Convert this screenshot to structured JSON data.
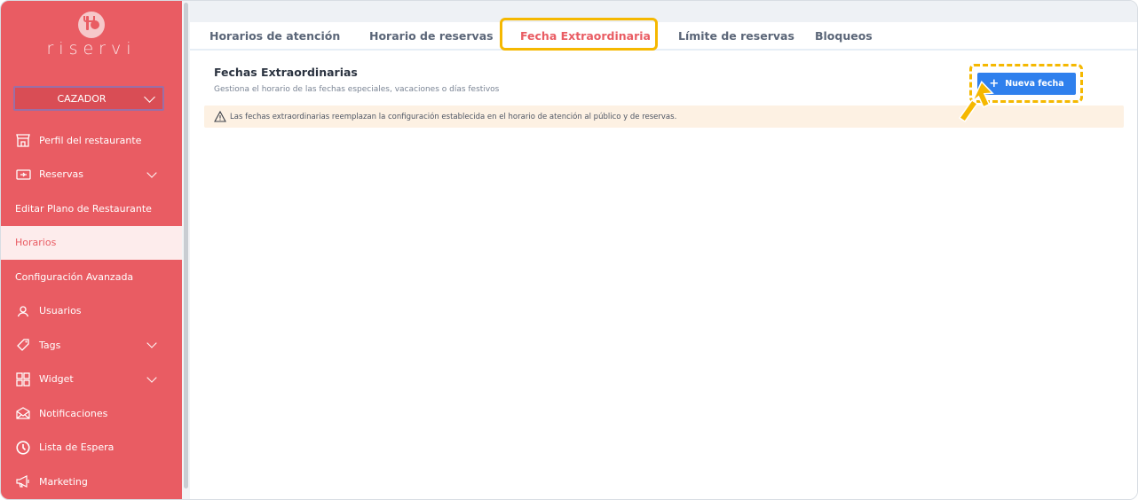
{
  "app": {
    "logo_text": "riservi"
  },
  "restaurant_select": {
    "value": "CAZADOR"
  },
  "sidebar": {
    "items": [
      {
        "label": "Perfil del restaurante",
        "icon": "store-icon"
      },
      {
        "label": "Reservas",
        "icon": "ticket-icon",
        "has_chevron": true
      },
      {
        "label": "Editar Plano de Restaurante"
      },
      {
        "label": "Horarios",
        "active": true
      },
      {
        "label": "Configuración Avanzada"
      },
      {
        "label": "Usuarios",
        "icon": "user-icon"
      },
      {
        "label": "Tags",
        "icon": "tag-icon",
        "has_chevron": true
      },
      {
        "label": "Widget",
        "icon": "widget-icon",
        "has_chevron": true
      },
      {
        "label": "Notificaciones",
        "icon": "mail-icon"
      },
      {
        "label": "Lista de Espera",
        "icon": "clock-icon"
      },
      {
        "label": "Marketing",
        "icon": "megaphone-icon"
      }
    ]
  },
  "tabs": [
    {
      "label": "Horarios de atención"
    },
    {
      "label": "Horario de reservas"
    },
    {
      "label": "Fecha Extraordinaria",
      "active": true
    },
    {
      "label": "Límite de reservas"
    },
    {
      "label": "Bloqueos"
    }
  ],
  "section": {
    "title": "Fechas Extraordinarias",
    "subtitle": "Gestiona el horario de las fechas especiales, vacaciones o días festivos",
    "notice": "Las fechas extraordinarias reemplazan la configuración establecida en el horario de atención al público y de reservas.",
    "new_button": "Nueva fecha"
  },
  "colors": {
    "brand": "#e95c63",
    "primary_button": "#2f80ed",
    "highlight": "#f5b800",
    "notice_bg": "#fdf1e3"
  }
}
